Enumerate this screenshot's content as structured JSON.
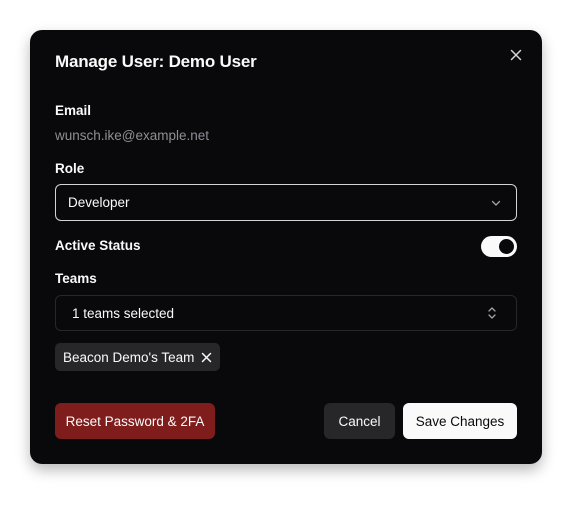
{
  "dialog": {
    "title": "Manage User: Demo User",
    "close_icon": "close-icon"
  },
  "email": {
    "label": "Email",
    "value": "wunsch.ike@example.net"
  },
  "role": {
    "label": "Role",
    "selected": "Developer",
    "icon": "chevron-down-icon"
  },
  "active_status": {
    "label": "Active Status",
    "enabled": true
  },
  "teams": {
    "label": "Teams",
    "summary": "1 teams selected",
    "icon": "chevrons-up-down-icon",
    "chips": [
      {
        "label": "Beacon Demo's Team"
      }
    ]
  },
  "actions": {
    "reset_label": "Reset Password & 2FA",
    "cancel_label": "Cancel",
    "save_label": "Save Changes"
  },
  "colors": {
    "dialog_bg": "#09090b",
    "danger": "#7f1d1d",
    "secondary": "#27272a",
    "primary_fg": "#fafafa",
    "muted_text": "#8e8e96"
  }
}
